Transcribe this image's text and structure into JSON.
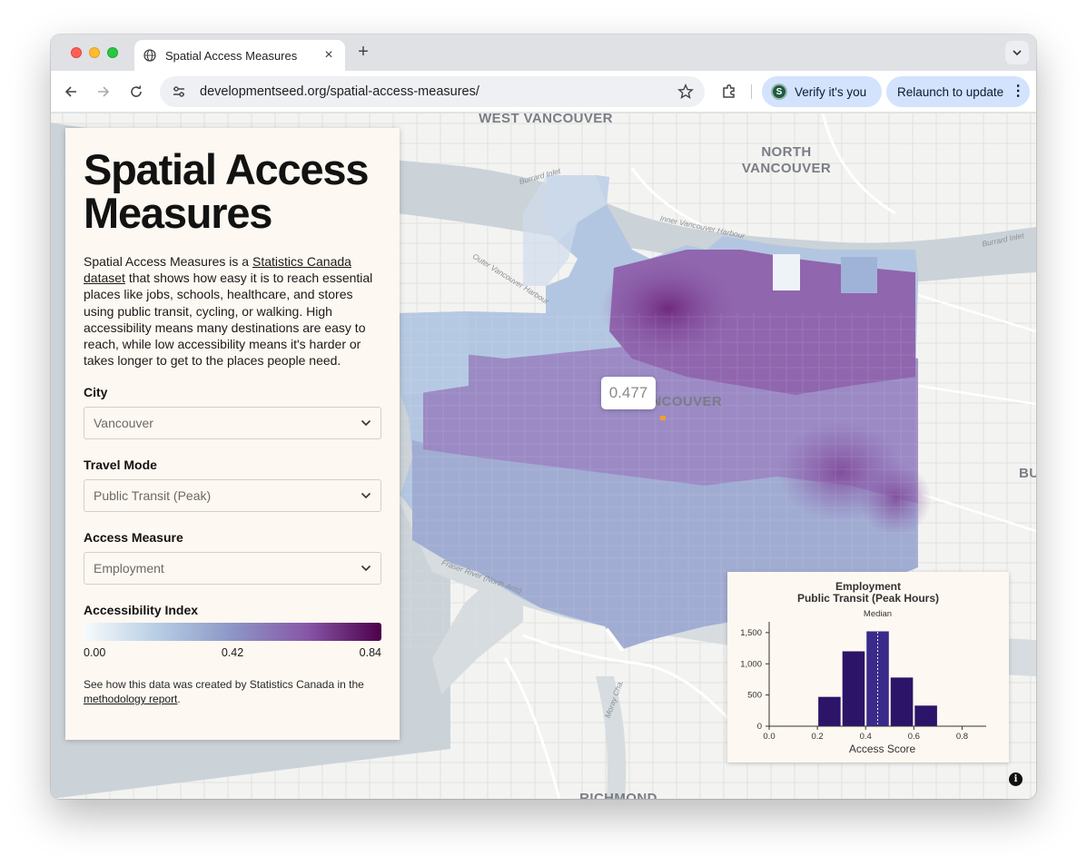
{
  "browser": {
    "tab_title": "Spatial Access Measures",
    "url": "developmentseed.org/spatial-access-measures/",
    "verify_label": "Verify it's you",
    "verify_avatar_letter": "S",
    "relaunch_label": "Relaunch to update"
  },
  "map": {
    "place_labels": {
      "west_vancouver": "WEST VANCOUVER",
      "north_vancouver": "NORTH\nVANCOUVER",
      "vancouver": "VANCOUVER",
      "burnaby": "BU",
      "richmond": "RICHMOND"
    },
    "water_labels": {
      "burrard_inlet_left": "Burrard Inlet",
      "burrard_inlet_right": "Burrard Inlet",
      "inner_harbour": "Inner Vancouver Harbour",
      "outer_harbour": "Outer Vancouver Harbour",
      "fraser_north_arm": "Fraser River (North Arm)",
      "moray_channel": "Moray Cha."
    },
    "tooltip_value": "0.477",
    "colors": {
      "low": "#f7fbfd",
      "mid": "#8c96c6",
      "high": "#4d004b",
      "marker": "#f0a030"
    }
  },
  "panel": {
    "title": "Spatial Access Measures",
    "desc_prefix": "Spatial Access Measures is a ",
    "desc_link": "Statistics Canada dataset",
    "desc_rest": " that shows how easy it is to reach essential places like jobs, schools, healthcare, and stores using public transit, cycling, or walking. High accessibility means many destinations are easy to reach, while low accessibility means it's harder or takes longer to get to the places people need.",
    "city_label": "City",
    "city_value": "Vancouver",
    "travel_mode_label": "Travel Mode",
    "travel_mode_value": "Public Transit (Peak)",
    "access_measure_label": "Access Measure",
    "access_measure_value": "Employment",
    "legend_title": "Accessibility Index",
    "legend_ticks": [
      "0.00",
      "0.42",
      "0.84"
    ],
    "footnote_prefix": "See how this data was created by Statistics Canada in the ",
    "footnote_link": "methodology report",
    "footnote_suffix": "."
  },
  "chart_data": {
    "type": "bar",
    "title": "Employment",
    "subtitle": "Public Transit (Peak Hours)",
    "xlabel": "Access Score",
    "ylabel": "",
    "bins": [
      [
        0.2,
        0.3
      ],
      [
        0.3,
        0.4
      ],
      [
        0.4,
        0.5
      ],
      [
        0.5,
        0.6
      ],
      [
        0.6,
        0.7
      ],
      [
        0.7,
        0.8
      ],
      [
        0.8,
        0.9
      ]
    ],
    "values": [
      470,
      1200,
      1520,
      780,
      330,
      5,
      0
    ],
    "xlim": [
      0,
      0.9
    ],
    "ylim": [
      0,
      1600
    ],
    "xticks": [
      "0.0",
      "0.2",
      "0.4",
      "0.6",
      "0.8"
    ],
    "xtick_values": [
      0,
      0.2,
      0.4,
      0.6,
      0.8
    ],
    "yticks": [
      "0",
      "500",
      "1,000",
      "1,500"
    ],
    "ytick_values": [
      0,
      500,
      1000,
      1500
    ],
    "median": 0.45,
    "median_label": "Median",
    "bar_color": "#2c1469",
    "median_bar_color": "#3a2a8a"
  }
}
